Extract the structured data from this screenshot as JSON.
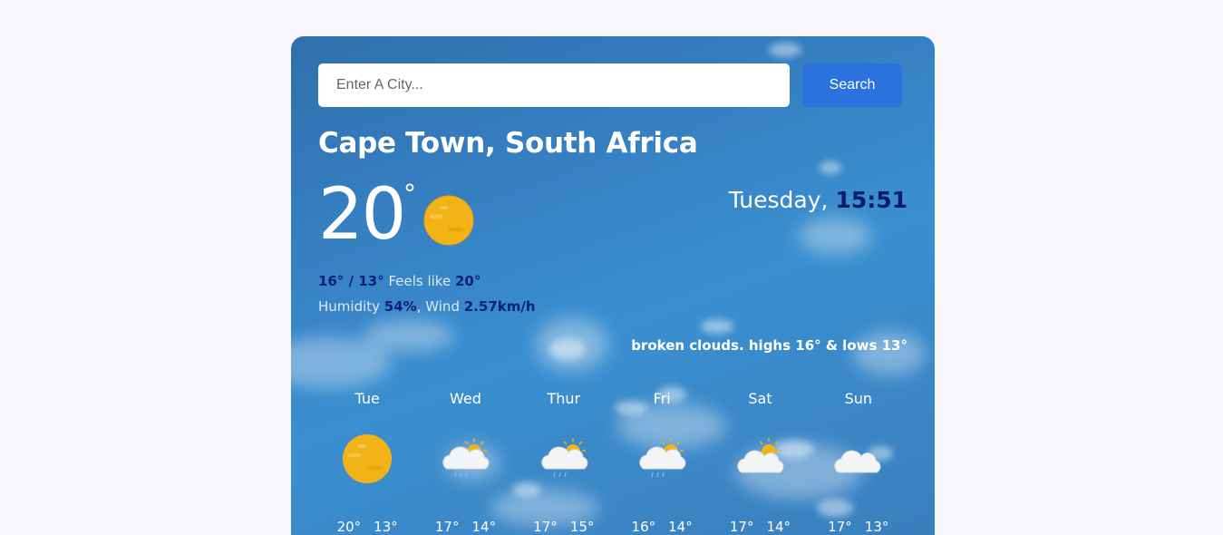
{
  "search": {
    "placeholder": "Enter A City...",
    "button_label": "Search"
  },
  "current": {
    "city": "Cape Town, South Africa",
    "temp": "20",
    "deg_symbol": "°",
    "icon": "sun-icon",
    "day": "Tuesday,",
    "time": "15:51",
    "hi_lo": "16° / 13°",
    "feels_label": "Feels like",
    "feels": "20°",
    "humidity_label": "Humidity",
    "humidity": "54%",
    "wind_sep": ",",
    "wind_label": "Wind",
    "wind": "2.57km/h",
    "description": "broken clouds. highs 16° & lows 13°"
  },
  "forecast": [
    {
      "day": "Tue",
      "icon": "sun-icon",
      "high": "20°",
      "low": "13°"
    },
    {
      "day": "Wed",
      "icon": "sun-cloud-rain-icon",
      "high": "17°",
      "low": "14°"
    },
    {
      "day": "Thur",
      "icon": "sun-cloud-rain-icon",
      "high": "17°",
      "low": "15°"
    },
    {
      "day": "Fri",
      "icon": "sun-cloud-rain-icon",
      "high": "16°",
      "low": "14°"
    },
    {
      "day": "Sat",
      "icon": "sun-cloud-icon",
      "high": "17°",
      "low": "14°"
    },
    {
      "day": "Sun",
      "icon": "cloud-icon",
      "high": "17°",
      "low": "13°"
    }
  ],
  "colors": {
    "background": "#f6f6fb",
    "card": "#3680c2",
    "button": "#2a73de",
    "highlight": "#0c2080",
    "time": "#0b1b68"
  }
}
